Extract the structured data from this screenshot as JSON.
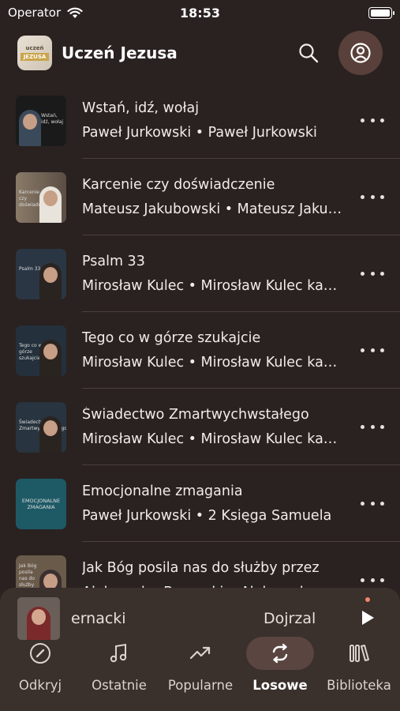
{
  "status": {
    "carrier": "Operator",
    "time": "18:53"
  },
  "header": {
    "app_title": "Uczeń Jezusa",
    "logo_top": "uczeń",
    "logo_band": "JEZUSA"
  },
  "items": [
    {
      "title": "Wstań, idź, wołaj",
      "subtitle": "Paweł Jurkowski • Paweł Jurkowski",
      "thumb_caption": "Wstań, idź, wołaj",
      "thumb_bg": "#1a1a1a"
    },
    {
      "title": "Karcenie czy doświadczenie",
      "subtitle": "Mateusz Jakubowski • Mateusz Jakubowski",
      "thumb_caption": "Karcenie czy doświadczenie",
      "thumb_bg": "#7a6a5a"
    },
    {
      "title": "Psalm 33",
      "subtitle": "Mirosław Kulec • Mirosław Kulec kazania",
      "thumb_caption": "Psalm 33",
      "thumb_bg": "#2a3a4a"
    },
    {
      "title": "Tego co w górze szukajcie",
      "subtitle": "Mirosław Kulec • Mirosław Kulec kazania",
      "thumb_caption": "Tego co w górze szukajcie",
      "thumb_bg": "#2a3a4a"
    },
    {
      "title": "Świadectwo Zmartwychwstałego",
      "subtitle": "Mirosław Kulec • Mirosław Kulec kazania",
      "thumb_caption": "Świadectwo Zmartwychwstałego",
      "thumb_bg": "#2a3a4a"
    },
    {
      "title": "Emocjonalne zmagania",
      "subtitle": "Paweł Jurkowski • 2 Księga Samuela",
      "thumb_caption": "EMOCJONALNE ZMAGANIA",
      "thumb_bg": "#1e5a66"
    },
    {
      "title": "Jak Bóg posila nas do służby przez",
      "subtitle": "Aleksander Bernacki • Aleksander Bernacki",
      "thumb_caption": "Jak Bóg posila nas do służby przez",
      "thumb_bg": "#6a5a4a"
    }
  ],
  "player": {
    "artist": "ernacki",
    "title": "Dojrzal"
  },
  "tabs": [
    {
      "label": "Odkryj",
      "icon": "compass-icon",
      "active": false
    },
    {
      "label": "Ostatnie",
      "icon": "music-note-icon",
      "active": false
    },
    {
      "label": "Popularne",
      "icon": "trending-icon",
      "active": false
    },
    {
      "label": "Losowe",
      "icon": "shuffle-repeat-icon",
      "active": true
    },
    {
      "label": "Biblioteka",
      "icon": "library-icon",
      "active": false
    }
  ],
  "colors": {
    "background": "#2a2220",
    "bar": "#3a302c",
    "accent_pill": "#5a4540",
    "profile": "#5a403a",
    "indicator": "#f0866a"
  }
}
